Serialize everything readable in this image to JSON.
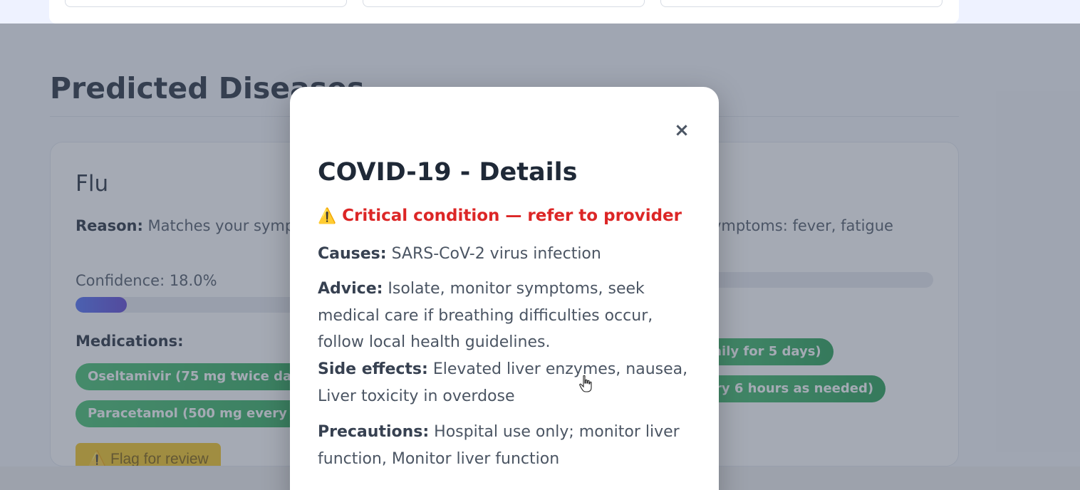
{
  "section": {
    "title": "Predicted Diseases"
  },
  "cards": [
    {
      "title": "Flu",
      "reason_label": "Reason:",
      "reason_text": "Matches your symptoms: fever, fatigue",
      "confidence_text": "Confidence: 18.0%",
      "confidence_value": 0.18,
      "medications_label": "Medications:",
      "medications": [
        "Oseltamivir (75 mg twice daily for 5 days)",
        "Paracetamol (500 mg every 6 hours as needed)"
      ],
      "flag_label": "Flag for review",
      "flag_icon": "warning-icon"
    },
    {
      "reason_text": "ymptoms: fever, fatigue",
      "medications": [
        "daily for 5 days)",
        "ry 6 hours as needed)"
      ]
    }
  ],
  "modal": {
    "close_label": "×",
    "title": "COVID-19 - Details",
    "alert_icon": "warning-icon",
    "alert_text": "Critical condition — refer to provider",
    "causes_label": "Causes:",
    "causes_text": "SARS-CoV-2 virus infection",
    "advice_label": "Advice:",
    "advice_text": "Isolate, monitor symptoms, seek medical care if breathing difficulties occur, follow local health guidelines.",
    "side_effects_label": "Side effects:",
    "side_effects_text": "Elevated liver enzymes, nausea, Liver toxicity in overdose",
    "precautions_label": "Precautions:",
    "precautions_text": "Hospital use only; monitor liver function, Monitor liver function"
  },
  "colors": {
    "alert": "#dc2626",
    "pill": "#22a355",
    "flag": "#f5c518",
    "progress": "#4a6cf7"
  }
}
